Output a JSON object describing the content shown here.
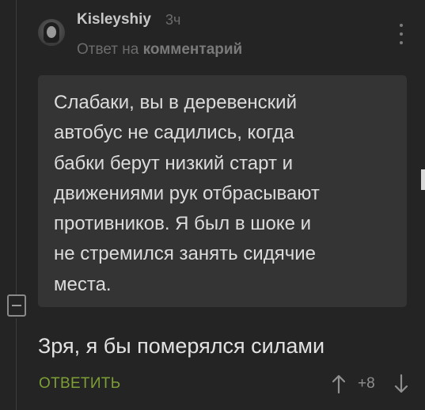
{
  "comment": {
    "author": "Kisleyshiy",
    "time": "3ч",
    "reply_prefix": "Ответ на",
    "reply_link": "комментарий",
    "quote_lines": [
      "Слабаки, вы в деревенский",
      "автобус не садились, когда",
      "бабки берут низкий старт и",
      "движениями рук отбрасывают",
      "противников. Я был в шоке и",
      "не стремился занять сидячие",
      "места."
    ],
    "text": "Зря, я бы померялся силами",
    "reply_button": "ОТВЕТИТЬ",
    "rating": "+8"
  },
  "colors": {
    "background": "#242424",
    "quote_background": "#343434",
    "reply_button": "#7d9f35"
  },
  "icons": {
    "avatar": "user-avatar",
    "more": "vertical-dots-icon",
    "collapse": "minus-square-icon",
    "upvote": "arrow-up-icon",
    "downvote": "arrow-down-icon"
  }
}
